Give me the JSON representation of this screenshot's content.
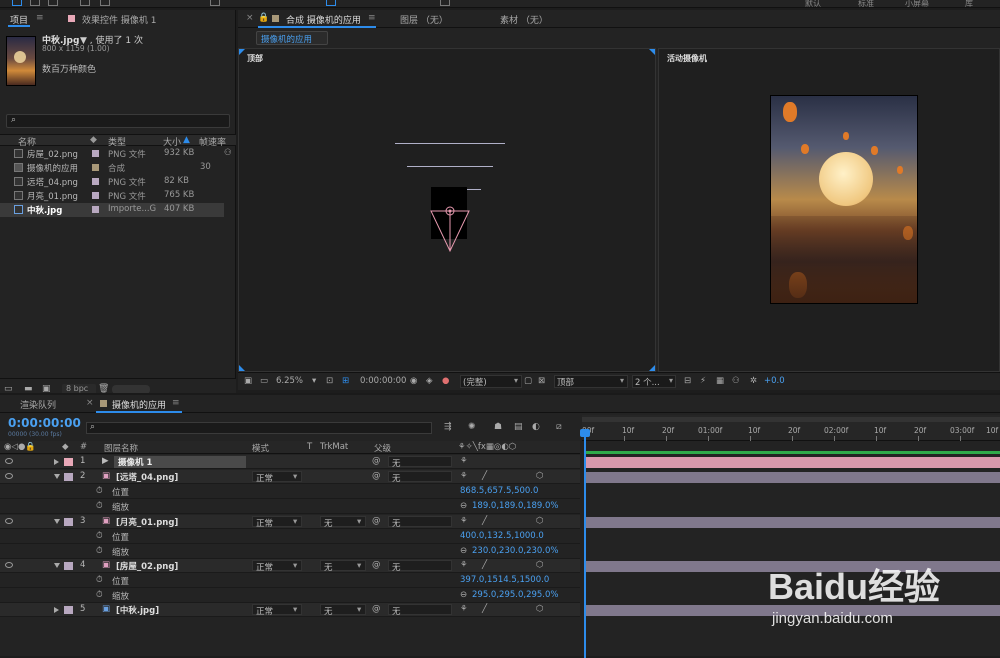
{
  "topbar": {
    "labels": [
      "默认",
      "标准",
      "小屏幕",
      "库"
    ]
  },
  "project": {
    "tabs": [
      "项目",
      "效果控件 摄像机 1"
    ],
    "preview": {
      "filename": "中秋.jpg",
      "used": "▼ , 使用了 1 次",
      "dims": "800 x 1159 (1.00)",
      "colors": "数百万种颜色"
    },
    "search_placeholder": "",
    "columns": [
      "名称",
      "类型",
      "大小",
      "帧速率"
    ],
    "items": [
      {
        "name": "房屋_02.png",
        "type": "PNG 文件",
        "size": "932 KB",
        "fps": "",
        "color": "#b8a8c0"
      },
      {
        "name": "摄像机的应用",
        "type": "合成",
        "size": "",
        "fps": "30",
        "color": "#a89878"
      },
      {
        "name": "远塔_04.png",
        "type": "PNG 文件",
        "size": "82 KB",
        "fps": "",
        "color": "#b8a8c0"
      },
      {
        "name": "月亮_01.png",
        "type": "PNG 文件",
        "size": "765 KB",
        "fps": "",
        "color": "#b8a8c0"
      },
      {
        "name": "中秋.jpg",
        "type": "Importe...G",
        "size": "407 KB",
        "fps": "",
        "color": "#b8a8c0"
      }
    ],
    "bpc": "8 bpc"
  },
  "comp": {
    "tabs": [
      "合成 摄像机的应用",
      "图层 （无）",
      "素材 （无）"
    ],
    "subtab": "摄像机的应用",
    "view_left_label": "顶部",
    "view_right_label": "活动摄像机",
    "zoom": "6.25%",
    "time": "0:00:00:00",
    "quality": "(完整)",
    "view_mode": "顶部",
    "view_count": "2 个...",
    "exposure": "+0.0"
  },
  "timeline": {
    "tabs": [
      "渲染队列",
      "摄像机的应用"
    ],
    "timecode": "0:00:00:00",
    "fps_text": "00000 (30.00 fps)",
    "columns": [
      "#",
      "图层名称",
      "模式",
      "T",
      "TrkMat",
      "父级"
    ],
    "ruler": [
      "00f",
      "10f",
      "20f",
      "01:00f",
      "10f",
      "20f",
      "02:00f",
      "10f",
      "20f",
      "03:00f",
      "10f"
    ],
    "layers": [
      {
        "num": "1",
        "name": "摄像机 1",
        "mode": "",
        "trkmat": "",
        "parent": "无",
        "color": "#e8a8b8",
        "expanded": false,
        "props": []
      },
      {
        "num": "2",
        "name": "[远塔_04.png]",
        "mode": "正常",
        "trkmat": "",
        "parent": "无",
        "color": "#b8a8c0",
        "expanded": true,
        "props": [
          {
            "name": "位置",
            "value": "868.5,657.5,500.0"
          },
          {
            "name": "缩放",
            "value": "189.0,189.0,189.0%"
          }
        ]
      },
      {
        "num": "3",
        "name": "[月亮_01.png]",
        "mode": "正常",
        "trkmat": "无",
        "parent": "无",
        "color": "#b8a8c0",
        "expanded": true,
        "props": [
          {
            "name": "位置",
            "value": "400.0,132.5,1000.0"
          },
          {
            "name": "缩放",
            "value": "230.0,230.0,230.0%"
          }
        ]
      },
      {
        "num": "4",
        "name": "[房屋_02.png]",
        "mode": "正常",
        "trkmat": "无",
        "parent": "无",
        "color": "#b8a8c0",
        "expanded": true,
        "props": [
          {
            "name": "位置",
            "value": "397.0,1514.5,1500.0"
          },
          {
            "name": "缩放",
            "value": "295.0,295.0,295.0%"
          }
        ]
      },
      {
        "num": "5",
        "name": "[中秋.jpg]",
        "mode": "正常",
        "trkmat": "无",
        "parent": "无",
        "color": "#b8a8c0",
        "expanded": false,
        "props": []
      }
    ]
  },
  "watermark": {
    "brand": "Baidu经验",
    "url": "jingyan.baidu.com"
  }
}
